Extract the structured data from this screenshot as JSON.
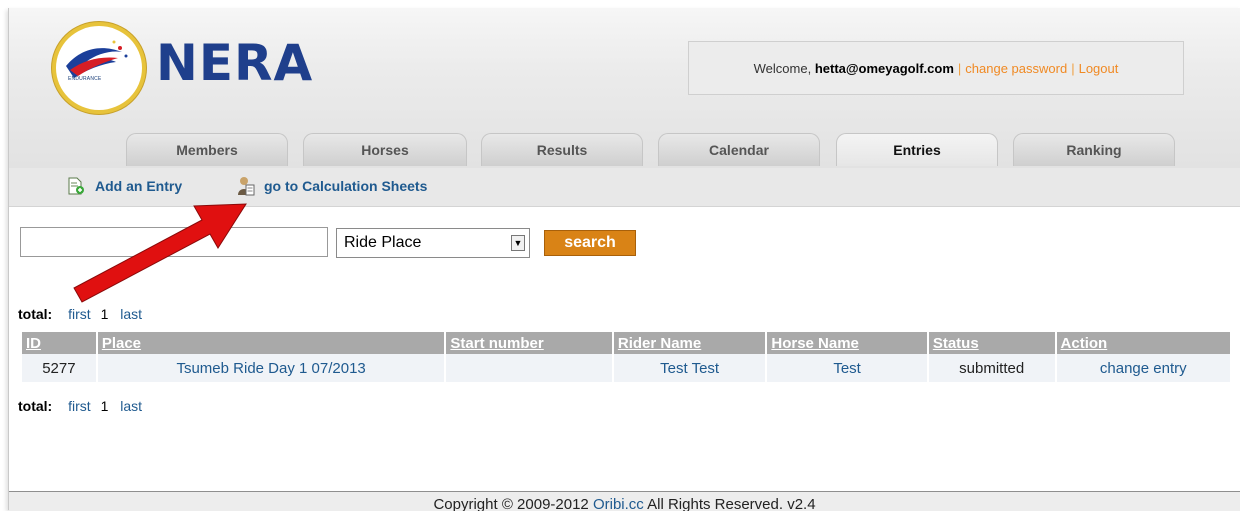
{
  "brand": {
    "logo_name": "NERA",
    "logo_first": "NE",
    "logo_rest": "RA",
    "logo_small_text": "ENDURANCE"
  },
  "account": {
    "welcome_prefix": "Welcome,",
    "email": "hetta@omeyagolf.com",
    "change_password": "change password",
    "logout": "Logout",
    "separator": "|"
  },
  "tabs": [
    {
      "label": "Members"
    },
    {
      "label": "Horses"
    },
    {
      "label": "Results"
    },
    {
      "label": "Calendar"
    },
    {
      "label": "Entries",
      "active": true
    },
    {
      "label": "Ranking"
    }
  ],
  "subnav": {
    "add_entry": "Add an Entry",
    "calc_sheets": "go to Calculation Sheets"
  },
  "search": {
    "input_value": "",
    "select_value": "Ride Place",
    "button": "search"
  },
  "pager": {
    "total_label": "total:",
    "first": "first",
    "current": "1",
    "last": "last"
  },
  "table": {
    "headers": [
      "ID",
      "Place",
      "Start number",
      "Rider Name",
      "Horse Name",
      "Status",
      "Action"
    ],
    "rows": [
      {
        "id": "5277",
        "place": "Tsumeb Ride Day 1 07/2013",
        "start_number": "",
        "rider": "Test Test",
        "horse": "Test",
        "status": "submitted",
        "action": "change entry"
      }
    ]
  },
  "footer": {
    "prefix": "Copyright © 2009-2012",
    "link": "Oribi.cc",
    "suffix": "All Rights Reserved. v2.4"
  },
  "colors": {
    "accent_orange": "#d98316",
    "link_blue": "#1f5a8f",
    "brand_blue": "#1f3f8c",
    "brand_red": "#d61e25",
    "annotation_arrow": "#e01010"
  }
}
